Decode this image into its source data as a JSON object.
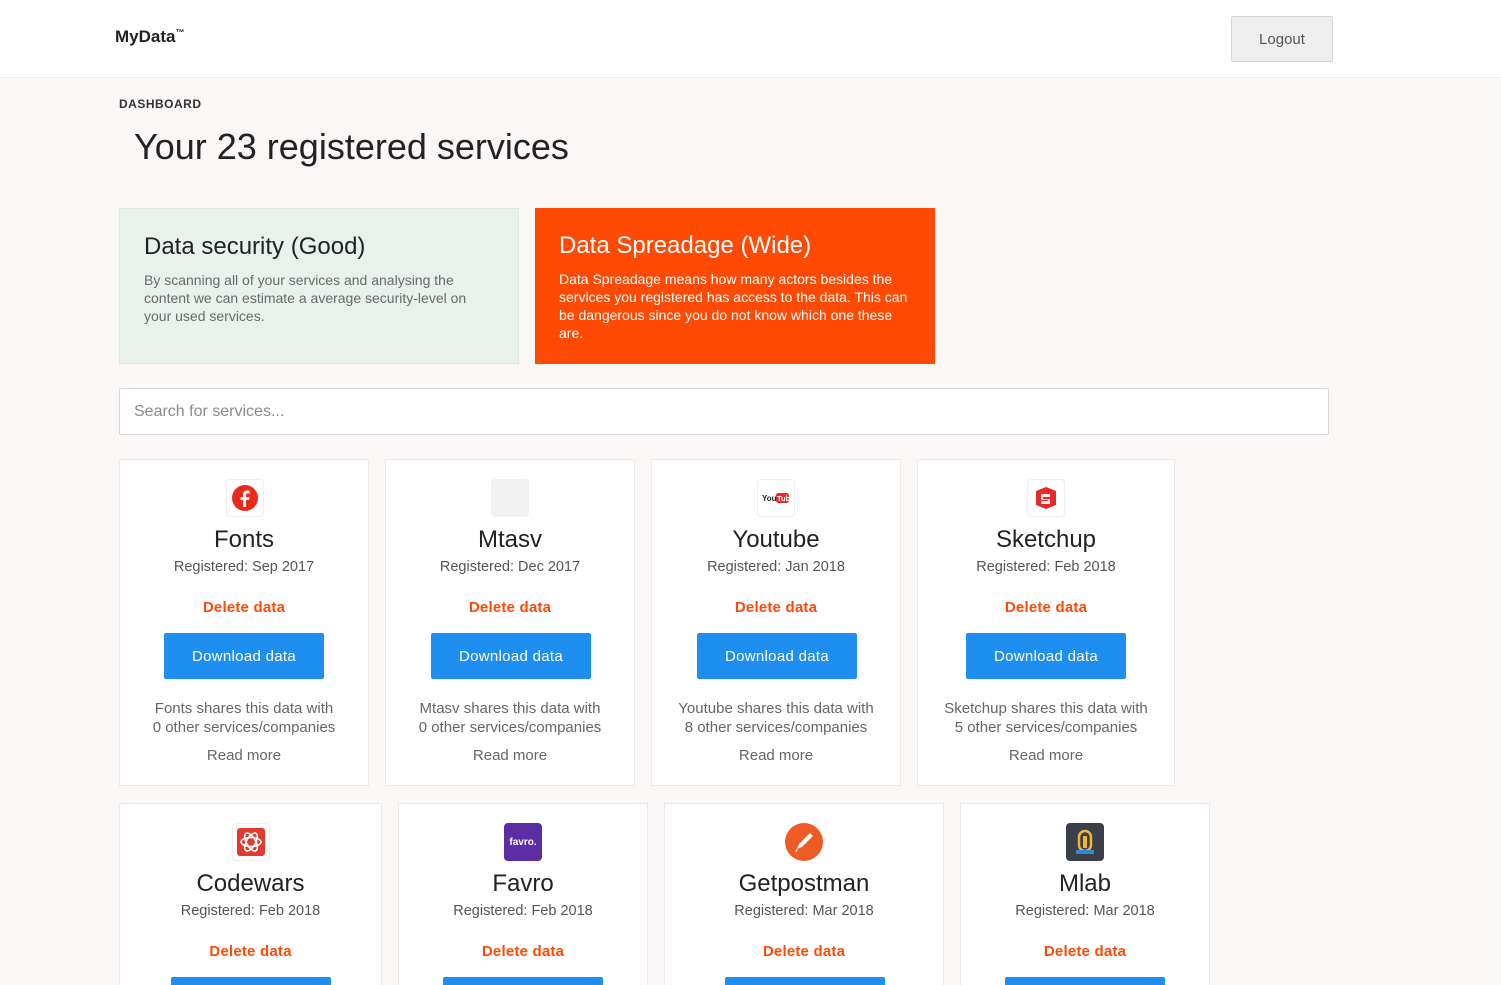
{
  "header": {
    "brand": "MyData",
    "brand_mark": "™",
    "logout_label": "Logout"
  },
  "breadcrumb": "DASHBOARD",
  "page_title": "Your 23 registered services",
  "info_cards": [
    {
      "title": "Data security (Good)",
      "text": "By scanning all of your services and analysing the content we can estimate a average security-level on your used services.",
      "color": "#e8f1eb"
    },
    {
      "title": "Data Spreadage (Wide)",
      "text": "Data Spreadage means how many actors besides the services you registered has access to the data. This can be dangerous since you do not know which one these are.",
      "color": "#ff4a05"
    }
  ],
  "search": {
    "placeholder": "Search for services..."
  },
  "actions": {
    "delete_label": "Delete data",
    "download_label": "Download data",
    "read_more": "Read more"
  },
  "services": [
    {
      "name": "Fonts",
      "registered": "Registered: Sep 2017",
      "share_line1": "Fonts shares this data with",
      "share_line2": "0 other services/companies",
      "icon": "fonts-icon",
      "logo_color": "#e8291c"
    },
    {
      "name": "Mtasv",
      "registered": "Registered: Dec 2017",
      "share_line1": "Mtasv shares this data with",
      "share_line2": "0 other services/companies",
      "icon": "blank-icon",
      "logo_color": "#f2f2f2"
    },
    {
      "name": "Youtube",
      "registered": "Registered: Jan 2018",
      "share_line1": "Youtube shares this data with",
      "share_line2": "8 other services/companies",
      "icon": "youtube-icon",
      "logo_color": "#e52d27"
    },
    {
      "name": "Sketchup",
      "registered": "Registered: Feb 2018",
      "share_line1": "Sketchup shares this data with",
      "share_line2": "5 other services/companies",
      "icon": "sketchup-icon",
      "logo_color": "#e72b2d"
    },
    {
      "name": "Codewars",
      "registered": "Registered: Feb 2018",
      "icon": "codewars-icon",
      "logo_color": "#e23a2e"
    },
    {
      "name": "Favro",
      "registered": "Registered: Feb 2018",
      "icon": "favro-icon",
      "logo_label": "favro.",
      "logo_color": "#5b2ea3"
    },
    {
      "name": "Getpostman",
      "registered": "Registered: Mar 2018",
      "icon": "postman-icon",
      "logo_color": "#ef5b25"
    },
    {
      "name": "Mlab",
      "registered": "Registered: Mar 2018",
      "icon": "mlab-icon",
      "logo_color": "#3a3f4a"
    }
  ]
}
